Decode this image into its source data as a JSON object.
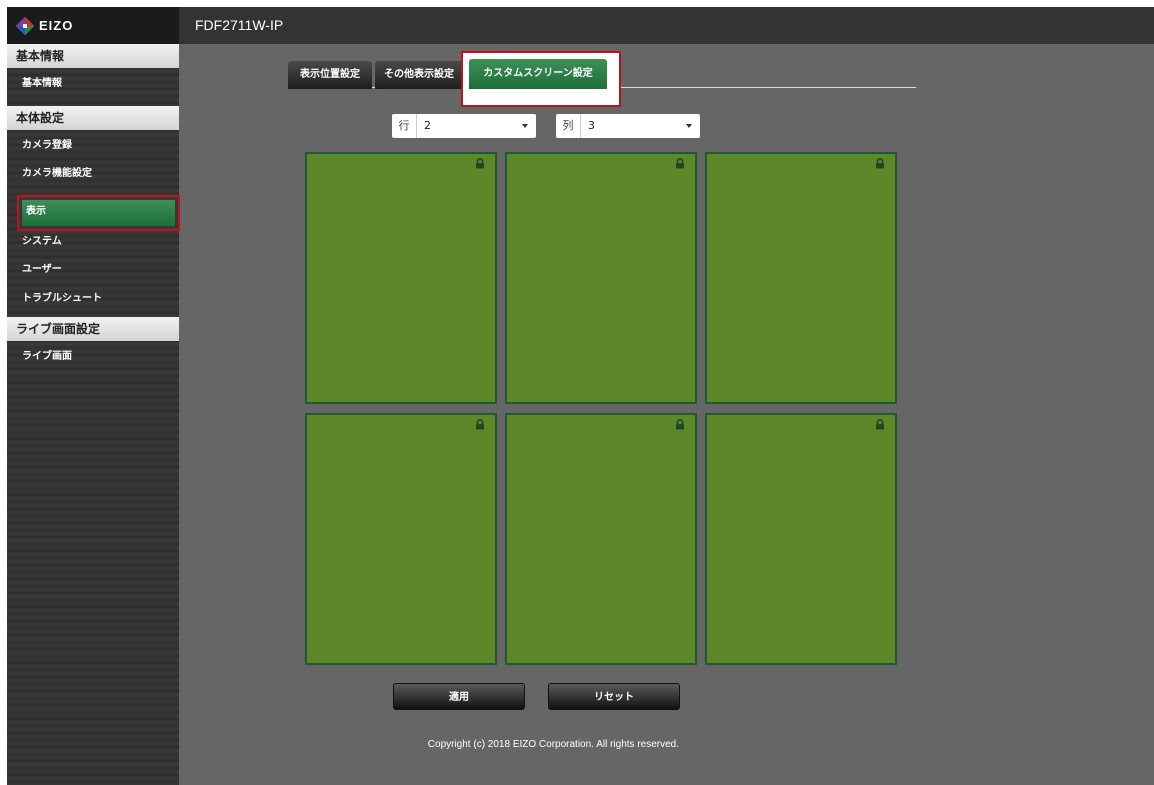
{
  "header": {
    "logo_text": "EIZO",
    "model": "FDF2711W-IP"
  },
  "sidebar": {
    "sections": [
      {
        "title": "基本情報",
        "items": [
          "基本情報"
        ]
      },
      {
        "title": "本体設定",
        "items": [
          "カメラ登録",
          "カメラ機能設定",
          "表示",
          "システム",
          "ユーザー",
          "トラブルシュート"
        ]
      },
      {
        "title": "ライブ画面設定",
        "items": [
          "ライブ画面"
        ]
      }
    ],
    "active_item": "表示"
  },
  "tabs": [
    "表示位置設定",
    "その他表示設定",
    "カスタムスクリーン設定"
  ],
  "active_tab": "カスタムスクリーン設定",
  "layout_select": {
    "row_label": "行",
    "row_value": "2",
    "col_label": "列",
    "col_value": "3"
  },
  "grid": {
    "rows": 2,
    "cols": 3,
    "cell_color": "#5d8729",
    "cell_border": "#1d5b36",
    "cell_icon": "lock-icon"
  },
  "buttons": {
    "apply": "適用",
    "reset": "リセット"
  },
  "footer": {
    "copyright": "Copyright (c) 2018 EIZO Corporation. All rights reserved."
  },
  "colors": {
    "accent_green": "#2e7d48",
    "highlight_red": "#c0121c"
  }
}
